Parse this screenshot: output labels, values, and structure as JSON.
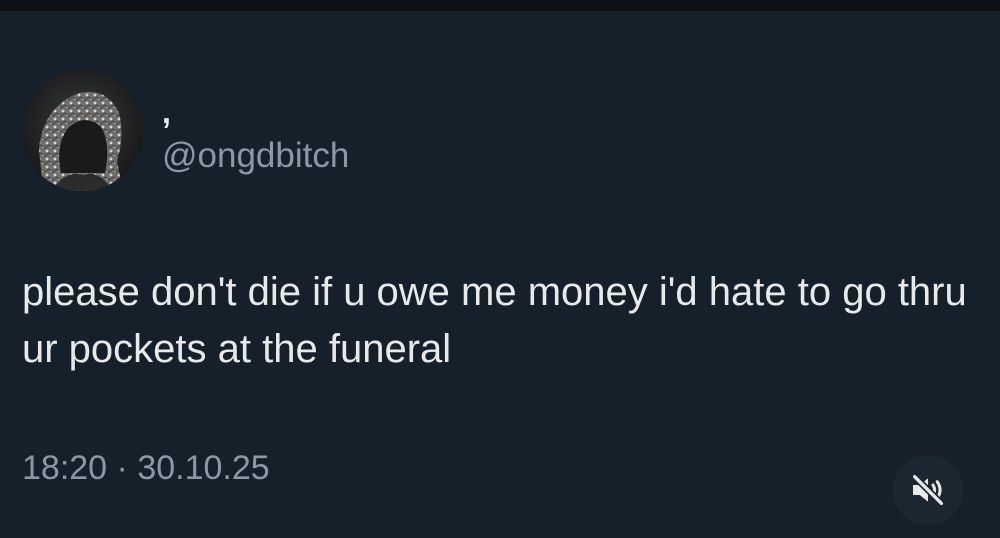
{
  "tweet": {
    "author": {
      "display_name": ",",
      "handle": "@ongdbitch",
      "avatar_icon": "hooded-figure-avatar"
    },
    "text": "please don't die if u owe me money i'd hate to go thru ur pockets at the funeral",
    "time": "18:20",
    "separator": "·",
    "date": "30.10.25"
  },
  "media_controls": {
    "mute_icon": "speaker-muted-icon"
  },
  "colors": {
    "background": "#15202b",
    "primary_text": "#e7e9ea",
    "secondary_text": "#8b98a5"
  }
}
